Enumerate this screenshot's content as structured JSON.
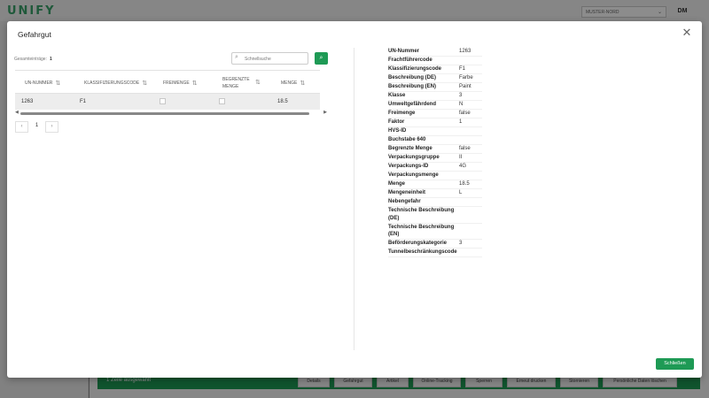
{
  "app": {
    "logo": "UNIFY",
    "tenant": "MUSTER-NORD",
    "avatar": "DM"
  },
  "action_bar": {
    "selection": "1 Zeile ausgewählt",
    "buttons": [
      "Details",
      "Gefahrgut",
      "Artikel",
      "Online-Tracking",
      "Sperren",
      "Erneut drucken",
      "Stornieren",
      "Persönliche Daten löschen"
    ]
  },
  "modal": {
    "title": "Gefahrgut",
    "close_label": "Schließen",
    "total_label": "Gesamteinträge:",
    "total_count": "1",
    "search_placeholder": "Schnellsuche",
    "columns": [
      "UN-Nummer",
      "Klassifizierungscode",
      "Freimenge",
      "Begrenzte Menge",
      "Menge"
    ],
    "row": {
      "un_nummer": "1263",
      "klassifizierungscode": "F1",
      "menge": "18.5"
    },
    "pager": {
      "prev": "‹",
      "current": "1",
      "next": "›"
    },
    "details": [
      {
        "k": "UN-Nummer",
        "v": "1263"
      },
      {
        "k": "Frachtführercode",
        "v": ""
      },
      {
        "k": "Klassifizierungscode",
        "v": "F1"
      },
      {
        "k": "Beschreibung (DE)",
        "v": "Farbe"
      },
      {
        "k": "Beschreibung (EN)",
        "v": "Paint"
      },
      {
        "k": "Klasse",
        "v": "3"
      },
      {
        "k": "Umweltgefährdend",
        "v": "N"
      },
      {
        "k": "Freimenge",
        "v": "false"
      },
      {
        "k": "Faktor",
        "v": "1"
      },
      {
        "k": "HVS-ID",
        "v": ""
      },
      {
        "k": "Buchstabe 640",
        "v": ""
      },
      {
        "k": "Begrenzte Menge",
        "v": "false"
      },
      {
        "k": "Verpackungsgruppe",
        "v": "II"
      },
      {
        "k": "Verpackungs-ID",
        "v": "4G"
      },
      {
        "k": "Verpackungsmenge",
        "v": ""
      },
      {
        "k": "Menge",
        "v": "18.5"
      },
      {
        "k": "Mengeneinheit",
        "v": "L"
      },
      {
        "k": "Nebengefahr",
        "v": ""
      },
      {
        "k": "Technische Beschreibung (DE)",
        "v": ""
      },
      {
        "k": "Technische Beschreibung (EN)",
        "v": ""
      },
      {
        "k": "Beförderungskategorie",
        "v": "3"
      },
      {
        "k": "Tunnelbeschränkungscode",
        "v": ""
      }
    ]
  }
}
